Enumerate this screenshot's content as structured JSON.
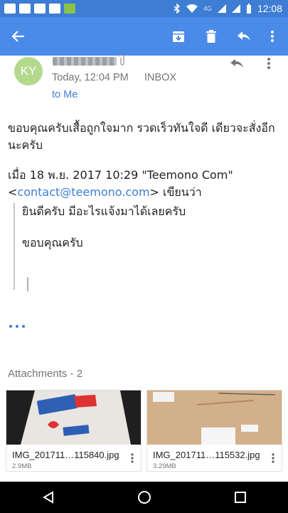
{
  "status_bar": {
    "network": "4G",
    "time": "12:08"
  },
  "app_bar": {
    "back": "arrow-back-icon",
    "archive": "archive-icon",
    "delete": "delete-icon",
    "reply": "reply-icon",
    "more": "more-vert-icon"
  },
  "colors": {
    "accent": "#4a8ae8",
    "status_bar": "#3d7dd4",
    "avatar": "#b3d98d",
    "link": "#3f7fd8"
  },
  "message": {
    "avatar_initials": "KY",
    "time": "Today, 12:04 PM",
    "folder": "INBOX",
    "recipient": "to Me",
    "body_paragraph": "ขอบคุณครับเสื้อถูกใจมาก รวดเร็วทันใจดี เดียวจะสั่งอีกนะครับ",
    "quote_header_prefix": "เมื่อ 18 พ.ย. 2017 10:29 \"Teemono Com\"",
    "quote_email_lt": "<",
    "quote_email": "contact@teemono.com",
    "quote_email_suffix": "> เขียนว่า",
    "quoted_line1": "ยินดีครับ มีอะไรแจ้งมาได้เลยครับ",
    "quoted_line2": "ขอบคุณครับ"
  },
  "attachments": {
    "title": "Attachments - 2",
    "items": [
      {
        "name": "IMG_201711…115840.jpg",
        "size": "2.9MB"
      },
      {
        "name": "IMG_201711…115532.jpg",
        "size": "3.29MB"
      }
    ]
  },
  "nav": {
    "back": "nav-back-icon",
    "home": "nav-home-icon",
    "recents": "nav-recents-icon"
  }
}
